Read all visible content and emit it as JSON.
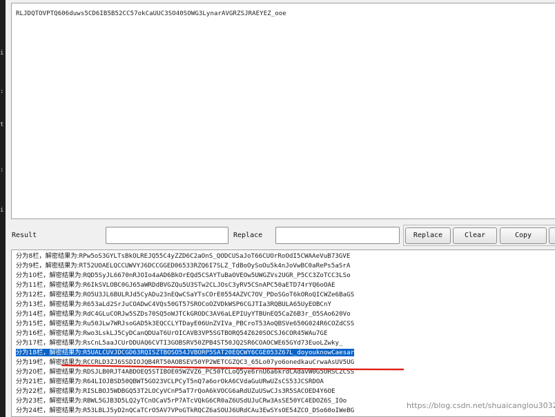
{
  "input": {
    "text": "RLJDQTOVPTQ606duws5CD6IB5B52CC57okCaUUC3SO40SOWG3LynarAVGRZSJRAEYEZ_ooe"
  },
  "controls": {
    "result_label": "Result",
    "result_value": "",
    "replace_label": "Replace",
    "replace_value": "",
    "replace_button": "Replace",
    "clear_button": "Clear",
    "copy_button": "Copy"
  },
  "results": [
    {
      "prefix": "分为8栏，解密结果为:",
      "value": "RPw5oS3GYLTsBkOLREJQ55C4yZZD6C2aOnS_QODCUSaJoT66CUOrRoOdI5CWAAeVuB73GVE"
    },
    {
      "prefix": "分为9栏，解密结果为:",
      "value": "RT52UOAELQCCUWVYJ6DCCGGED06533RZQ6I7SLZ_TdBoOySoOu5k4nJoVwBC0aRePs5aSrA"
    },
    {
      "prefix": "分为10栏，解密结果为:",
      "value": "RQD5SyJL6670nRJOIo4aAD6BkOrEQd5CSAYTuBaOVEOw5UWGZVs2UGR_P5CC3ZoTCC3LSo"
    },
    {
      "prefix": "分为11栏，解密结果为:",
      "value": "R6IkSVLOBC0GJ65aWRDdBVGZQu5U3STw2CLJOsC3yRV5CSnAPC50aETD74rYQ6oOAE"
    },
    {
      "prefix": "分为12栏，解密结果为:",
      "value": "RO5U3JL6BULRJd5CyADu23nEQwCSaYTsCOrE0554AZVC7OV_PDoSGoT6kORoQICWZe6BaGS"
    },
    {
      "prefix": "分为13栏，解密结果为:",
      "value": "R653aLd2SrJuCOADwC4VQs50GT57SROCoOZVDkWSP6CGJTIa3RQBULA65UyEOBCnY"
    },
    {
      "prefix": "分为14栏，解密结果为:",
      "value": "RdC4GLuCORJw5SZDs70SQ5oWJTCkGRODC3AV6aLEPIUyYTBUnEQ5CaZ6B3r_O5SAo620Vo"
    },
    {
      "prefix": "分为15栏，解密结果为:",
      "value": "Ru50JLw7WRJsoGAD5k3EQCCLYTDayE06UnZVIVa_PBCroT53AoQBSVe650G024R6COZdCSS"
    },
    {
      "prefix": "分为16栏，解密结果为:",
      "value": "Rwo3LskLJ5CyDCanQDUaT6UrOICAVB3VP5SGTBORQ54Z620SOCSJ6COR45WAu7GE"
    },
    {
      "prefix": "分为17栏，解密结果为:",
      "value": "RsCnL5aaJCUrDDUAQ6CVTI3GOBSRV50ZPB4ST50JQ2SR6COAOCWE65GYd73EuoLZwky_"
    },
    {
      "prefix": "分为18栏，解密结果为:",
      "value": "R5UALCUVJDCGD63RQISZTBOSO54JVBORP5SAT20EQCWY6CGE053Z67L_doyouknowCaesar"
    },
    {
      "prefix": "分为19栏，解密结果为:",
      "value": "RCCRLD3ZJ6SSDIOJQB4RT50AOBSEV50YP2WETCGZQC3_65Lo07yo6onedkauCrwaAsUV5UG"
    },
    {
      "prefix": "分为20栏，解密结果为:",
      "value": "RDSJLB0RJT4ABDOEQ5STIBOE05WZVZ6_PC50TCLoQ5ye6rnU6a6krdCAdavW0G5ORSCZCSS"
    },
    {
      "prefix": "分为21栏，解密结果为:",
      "value": "R64LIOJBSD50QBWT5GO23VCLPCyT5nQ7a6orOkA6CVdaGuURwUZsCS53JCSRDOA"
    },
    {
      "prefix": "分为22栏，解密结果为:",
      "value": "RISLBOJ5WDBGQ53T2LOCyVCnP5aT7rQoA6kVOCG6aRdUZuUSwCJs3R5SACOED4Y6OE"
    },
    {
      "prefix": "分为23栏，解密结果为:",
      "value": "RBWL5GJB3D5LQ2yTCnOCaV5rP7ATcVQkG6CR0aZ6USdUJuCRw3AsSE50YC4EDOZ6S_IOo"
    },
    {
      "prefix": "分为24栏，解密结果为:",
      "value": "R53LBLJ5yD2nQCaTCrO5AV7VPoGTkRQCZ6aSOUJ6URdCAu3EwSYsOE54ZCO_DSo60oIWeBG"
    }
  ],
  "selected_index": 10,
  "accent_color": "#0a63c8",
  "underline_color": "#e0231c",
  "watermark": "https://blog.csdn.net/shuaicanglou3032"
}
